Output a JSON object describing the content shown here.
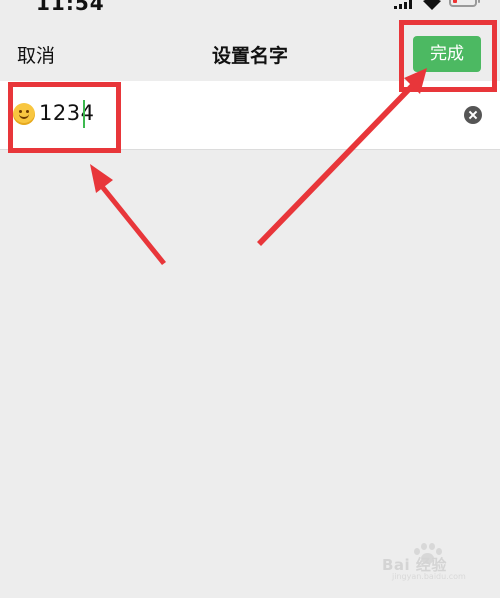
{
  "status_bar": {
    "time": "11:54"
  },
  "nav": {
    "cancel_label": "取消",
    "title": "设置名字",
    "done_label": "完成"
  },
  "name_field": {
    "value": "1234",
    "emoji": "😊"
  },
  "watermark": {
    "text": "Bai 经验",
    "sub": "jingyan.baidu.com"
  },
  "colors": {
    "accent": "#4cb962",
    "annotation": "#e8363a",
    "background": "#ededed",
    "field_background": "#ffffff"
  },
  "icons": [
    "signal-icon",
    "wifi-icon",
    "battery-icon",
    "emoji-icon",
    "clear-icon",
    "paw-icon"
  ]
}
